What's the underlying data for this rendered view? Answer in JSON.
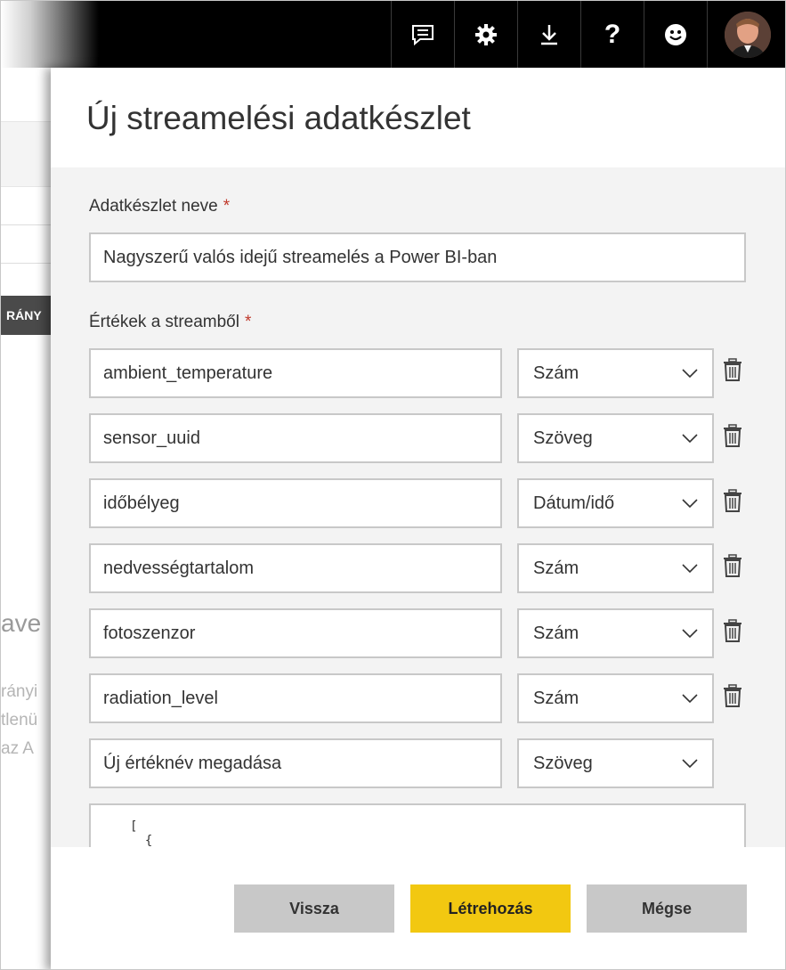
{
  "topbar": {
    "icons": [
      "feedback-icon",
      "gear-icon",
      "download-icon",
      "help-icon",
      "smiley-icon",
      "avatar"
    ]
  },
  "background_page": {
    "tag_text": "RÁNY",
    "big_text": "ave",
    "lines": [
      "rányi",
      "tlenü",
      "az A"
    ]
  },
  "panel": {
    "title": "Új streamelési adatkészlet",
    "dataset_name_label": "Adatkészlet neve",
    "dataset_name_required": "*",
    "dataset_name_value": "Nagyszerű valós idejű streamelés a Power BI-ban",
    "values_label": "Értékek a streamből",
    "values_required": "*",
    "rows": [
      {
        "name": "ambient_temperature",
        "type": "Szám"
      },
      {
        "name": "sensor_uuid",
        "type": "Szöveg"
      },
      {
        "name": "időbélyeg",
        "type": "Dátum/idő"
      },
      {
        "name": "nedvességtartalom",
        "type": "Szám"
      },
      {
        "name": "fotoszenzor",
        "type": "Szám"
      },
      {
        "name": "radiation_level",
        "type": "Szám"
      }
    ],
    "new_row": {
      "placeholder": "Új értéknév megadása",
      "type": "Szöveg"
    },
    "json_preview": "[\n  {"
  },
  "footer": {
    "back_label": "Vissza",
    "create_label": "Létrehozás",
    "cancel_label": "Mégse"
  },
  "colors": {
    "primary_button": "#f2c811",
    "secondary_button": "#c8c8c8",
    "required_star": "#c0392b",
    "topbar": "#000000"
  }
}
